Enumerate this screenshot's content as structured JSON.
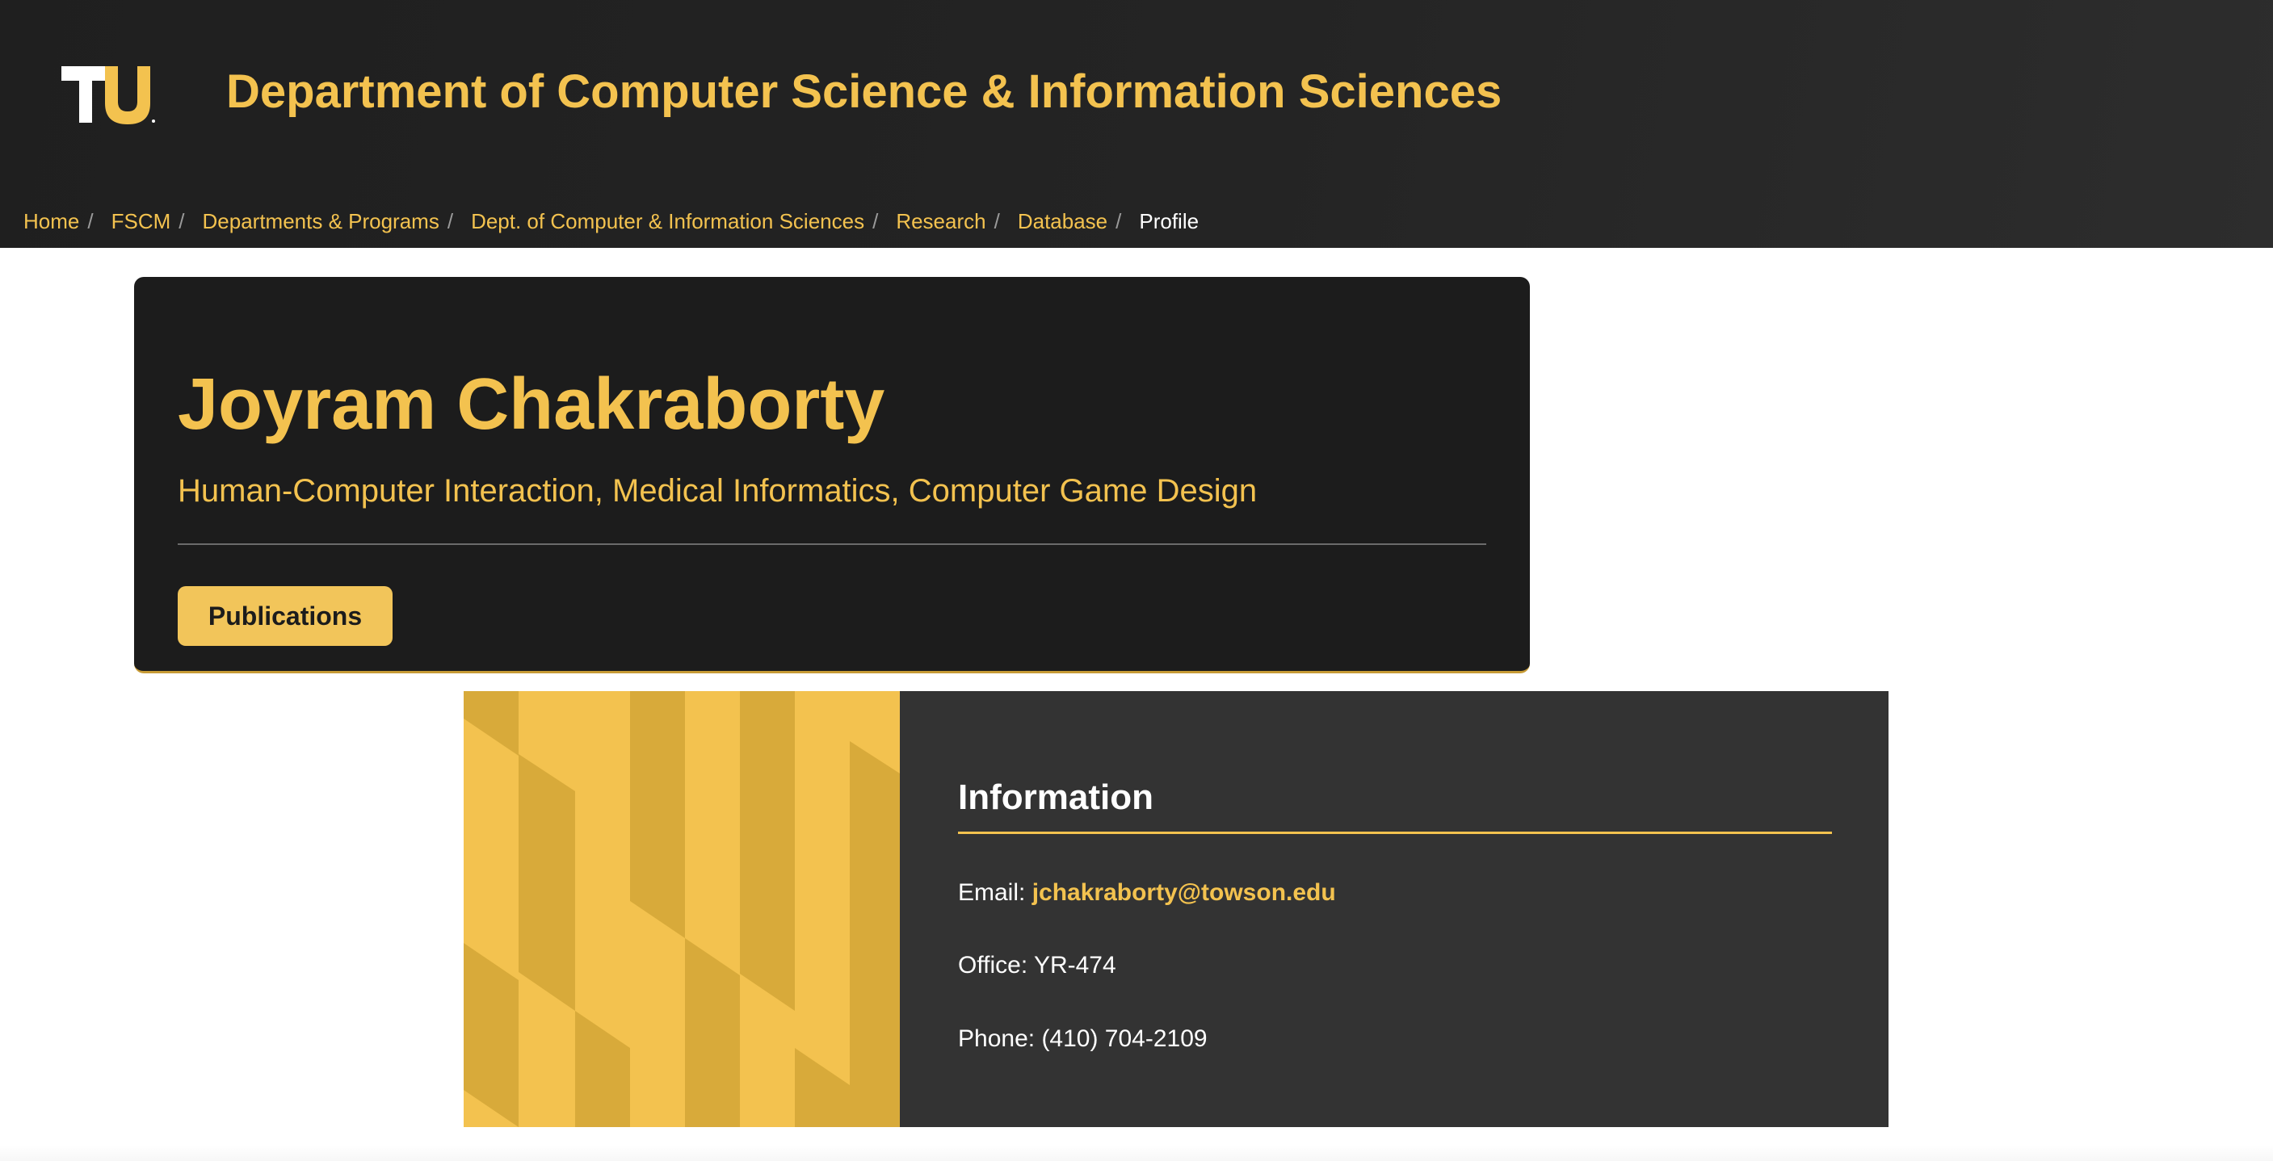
{
  "header": {
    "logo_text": "TU",
    "title": "Department of Computer Science & Information Sciences"
  },
  "breadcrumb": {
    "separator": "/",
    "items": [
      {
        "label": "Home"
      },
      {
        "label": "FSCM"
      },
      {
        "label": "Departments & Programs"
      },
      {
        "label": "Dept. of Computer & Information Sciences"
      },
      {
        "label": "Research"
      },
      {
        "label": "Database"
      }
    ],
    "current": "Profile"
  },
  "profile": {
    "name": "Joyram Chakraborty",
    "research_areas": "Human-Computer Interaction, Medical Informatics, Computer Game Design",
    "publications_button": "Publications"
  },
  "information": {
    "heading": "Information",
    "email_label": "Email:",
    "email_value": "jchakraborty@towson.edu",
    "office_label": "Office:",
    "office_value": "YR-474",
    "phone_label": "Phone:",
    "phone_value": "(410) 704-2109"
  },
  "colors": {
    "accent_gold": "#f3c24f",
    "header_dark": "#1f1f1f",
    "card_dark": "#1c1c1c",
    "info_panel": "#333333",
    "pattern_dark_gold": "#d8aa3a"
  },
  "icons": {
    "logo": "towson-tu-logo"
  }
}
